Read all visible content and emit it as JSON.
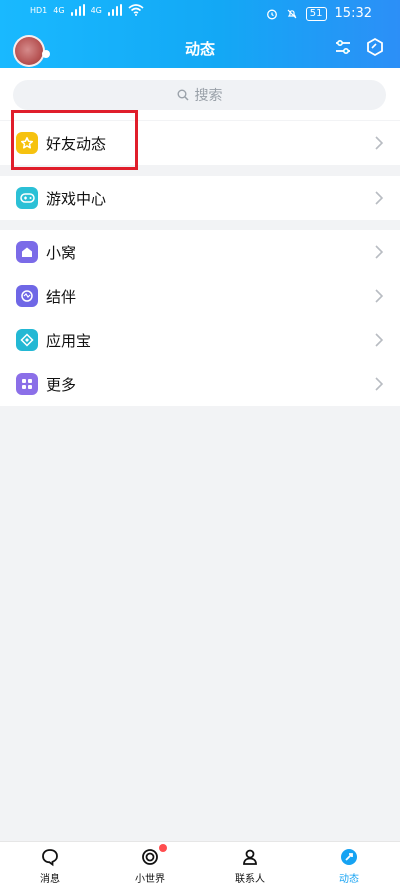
{
  "status_bar": {
    "left_labels": [
      "HD1",
      "HD2",
      "4G",
      "4G"
    ],
    "time": "15:32",
    "battery": "51"
  },
  "header": {
    "title": "动态"
  },
  "search": {
    "placeholder": "搜索"
  },
  "groups": [
    {
      "items": [
        {
          "label": "好友动态",
          "icon": "star-icon",
          "color": "#f6c20f"
        }
      ]
    },
    {
      "items": [
        {
          "label": "游戏中心",
          "icon": "gamepad-icon",
          "color": "#2bc0d6"
        }
      ]
    },
    {
      "items": [
        {
          "label": "小窝",
          "icon": "home-icon",
          "color": "#7b6be8"
        },
        {
          "label": "结伴",
          "icon": "chat-icon",
          "color": "#6f67e6"
        },
        {
          "label": "应用宝",
          "icon": "app-store-icon",
          "color": "#23b8d4"
        },
        {
          "label": "更多",
          "icon": "grid-icon",
          "color": "#8b6fe8"
        }
      ]
    }
  ],
  "tabs": [
    {
      "label": "消息",
      "icon": "message-icon",
      "active": false
    },
    {
      "label": "小世界",
      "icon": "world-icon",
      "active": false,
      "badge": true
    },
    {
      "label": "联系人",
      "icon": "contact-icon",
      "active": false
    },
    {
      "label": "动态",
      "icon": "moments-icon",
      "active": true
    }
  ],
  "colors": {
    "accent": "#16a3f3",
    "highlight_box": "#e01e2b"
  }
}
